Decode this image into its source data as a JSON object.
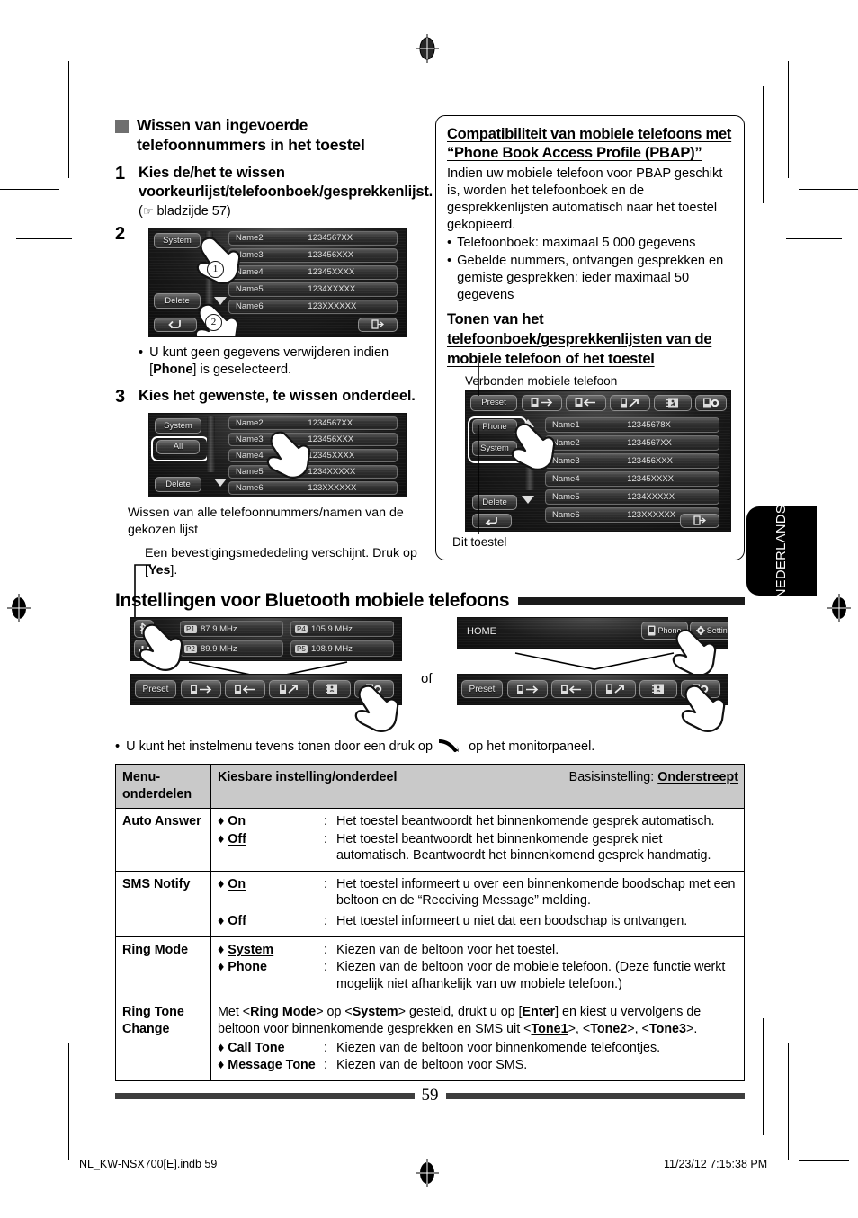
{
  "page": {
    "number": "59",
    "language_tab": "NEDERLANDS",
    "imprint_left": "NL_KW-NSX700[E].indb   59",
    "imprint_right": "11/23/12   7:15:38 PM"
  },
  "left_column": {
    "section_heading": "Wissen van ingevoerde telefoonnummers in het toestel",
    "step1": {
      "number": "1",
      "text": "Kies de/het te wissen voorkeurlijst/telefoonboek/gesprekkenlijst.",
      "reference": "bladzijde 57)"
    },
    "step2": {
      "number": "2"
    },
    "step2_note": {
      "bullet": "•",
      "text_before": "U kunt geen gegevens verwijderen indien [",
      "bold": "Phone",
      "text_after": "] is geselecteerd."
    },
    "step3": {
      "number": "3",
      "text": "Kies het gewenste, te wissen onderdeel."
    },
    "step3_caption": "Wissen van alle telefoonnummers/namen van de gekozen lijst",
    "step3_note_before": "Een bevestigingsmededeling verschijnt. Druk op [",
    "step3_note_bold": "Yes",
    "step3_note_after": "]."
  },
  "device_screen_step2": {
    "buttons": {
      "system": "System",
      "delete": "Delete"
    },
    "callouts": [
      "1",
      "2"
    ],
    "rows": [
      {
        "name": "Name2",
        "number": "1234567XX"
      },
      {
        "name": "Name3",
        "number": "123456XXX"
      },
      {
        "name": "Name4",
        "number": "12345XXXX"
      },
      {
        "name": "Name5",
        "number": "1234XXXXX"
      },
      {
        "name": "Name6",
        "number": "123XXXXXX"
      }
    ]
  },
  "device_screen_step3": {
    "buttons": {
      "system": "System",
      "all": "All",
      "delete": "Delete"
    },
    "rows": [
      {
        "name": "Name2",
        "number": "1234567XX"
      },
      {
        "name": "Name3",
        "number": "123456XXX"
      },
      {
        "name": "Name4",
        "number": "12345XXXX"
      },
      {
        "name": "Name5",
        "number": "1234XXXXX"
      },
      {
        "name": "Name6",
        "number": "123XXXXXX"
      }
    ]
  },
  "info_box": {
    "heading1": "Compatibiliteit van mobiele telefoons met “Phone Book Access Profile (PBAP)”",
    "paragraph": "Indien uw mobiele telefoon voor PBAP geschikt is, worden het telefoonboek en de gesprekkenlijsten automatisch naar het toestel gekopieerd.",
    "bullets": [
      "Telefoonboek: maximaal 5 000 gegevens",
      "Gebelde nummers, ontvangen gesprekken en gemiste gesprekken: ieder maximaal 50 gegevens"
    ],
    "heading2": "Tonen van het telefoonboek/gesprekkenlijsten van de mobiele telefoon of het toestel",
    "caption_top": "Verbonden mobiele telefoon",
    "caption_bottom": "Dit toestel",
    "device": {
      "toolbar_preset": "Preset",
      "buttons": {
        "phone": "Phone",
        "system": "System",
        "delete": "Delete"
      },
      "rows": [
        {
          "name": "Name1",
          "number": "12345678X"
        },
        {
          "name": "Name2",
          "number": "1234567XX"
        },
        {
          "name": "Name3",
          "number": "123456XXX"
        },
        {
          "name": "Name4",
          "number": "12345XXXX"
        },
        {
          "name": "Name5",
          "number": "1234XXXXX"
        },
        {
          "name": "Name6",
          "number": "123XXXXXX"
        }
      ]
    }
  },
  "bt_section": {
    "title": "Instellingen voor Bluetooth mobiele telefoons",
    "or_label": "of",
    "tuner_screen": {
      "presets": [
        {
          "label": "P1",
          "freq": "87.9 MHz"
        },
        {
          "label": "P4",
          "freq": "105.9 MHz"
        },
        {
          "label": "P2",
          "freq": "89.9 MHz"
        },
        {
          "label": "P5",
          "freq": "108.9 MHz"
        }
      ]
    },
    "home_screen": {
      "title": "HOME",
      "phone_label": "Phone",
      "settings_label": "Settings"
    },
    "toolbar_preset_label": "Preset",
    "note": {
      "bullet": "•",
      "before": "U kunt het instelmenu tevens tonen door een druk op",
      "after": "op het monitorpaneel."
    }
  },
  "table": {
    "headers": {
      "col1": "Menu-onderdelen",
      "col2": "Kiesbare instelling/onderdeel",
      "col3_prefix": "Basisinstelling: ",
      "col3_underlined": "Onderstreept"
    },
    "rows": [
      {
        "menu": "Auto Answer",
        "options": [
          {
            "marker": "♦",
            "name": "On",
            "underline": false,
            "colon": ":",
            "desc": "Het toestel beantwoordt het binnenkomende gesprek automatisch."
          },
          {
            "marker": "♦",
            "name": "Off",
            "underline": true,
            "colon": ":",
            "desc": "Het toestel beantwoordt het binnenkomende gesprek niet automatisch. Beantwoordt het binnenkomend gesprek handmatig."
          }
        ]
      },
      {
        "menu": "SMS Notify",
        "options": [
          {
            "marker": "♦",
            "name": "On",
            "underline": true,
            "colon": ":",
            "desc": "Het toestel informeert u over een binnenkomende boodschap met een beltoon en de “Receiving Message” melding."
          },
          {
            "marker": "♦",
            "name": "Off",
            "underline": false,
            "colon": ":",
            "desc": "Het toestel informeert u niet dat een boodschap is ontvangen."
          }
        ]
      },
      {
        "menu": "Ring Mode",
        "options": [
          {
            "marker": "♦",
            "name": "System",
            "underline": true,
            "colon": ":",
            "desc": "Kiezen van de beltoon voor het toestel."
          },
          {
            "marker": "♦",
            "name": "Phone",
            "underline": false,
            "colon": ":",
            "desc": "Kiezen van de beltoon voor de mobiele telefoon. (Deze functie werkt mogelijk niet afhankelijk van uw mobiele telefoon.)"
          }
        ]
      },
      {
        "menu": "Ring Tone Change",
        "intro": "Met <Ring Mode> op <System> gesteld, drukt u op [Enter] en kiest u vervolgens de beltoon voor binnenkomende gesprekken en SMS uit <Tone1>, <Tone2>, <Tone3>.",
        "options": [
          {
            "marker": "♦",
            "name": "Call Tone",
            "underline": false,
            "colon": ":",
            "desc": "Kiezen van de beltoon voor binnenkomende telefoontjes."
          },
          {
            "marker": "♦",
            "name": "Message Tone",
            "underline": false,
            "colon": ":",
            "desc": "Kiezen van de beltoon voor SMS."
          }
        ]
      }
    ]
  }
}
